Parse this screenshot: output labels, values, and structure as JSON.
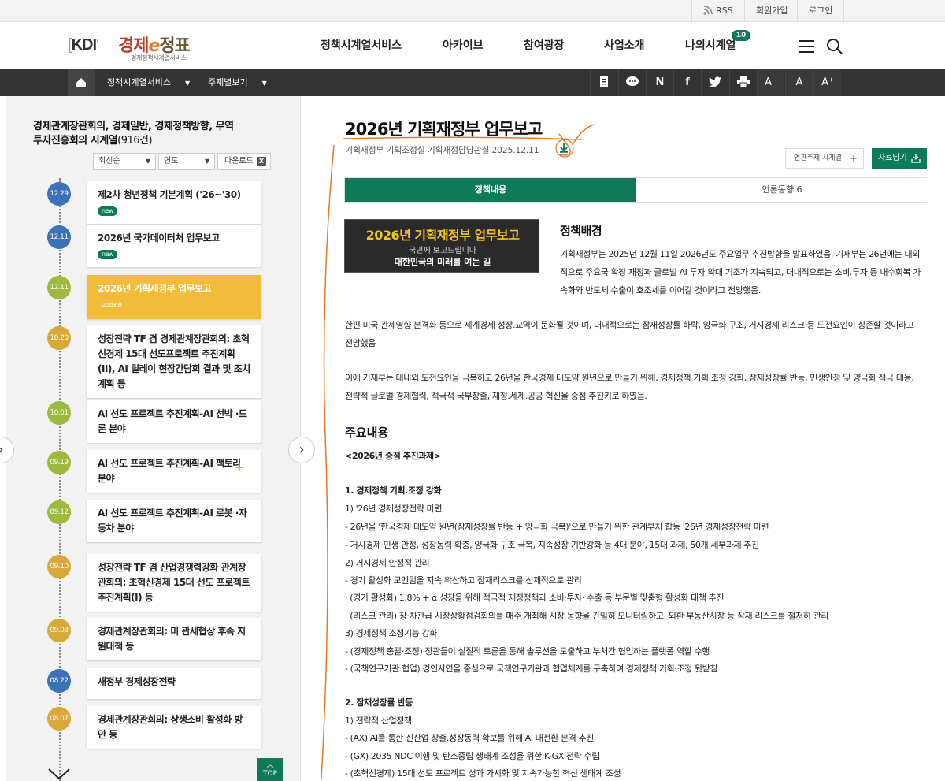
{
  "util": {
    "rss": "RSS",
    "signup": "회원가입",
    "login": "로그인"
  },
  "logo": {
    "kdi": "KDI",
    "kyungje": "경제",
    "e": "e",
    "jb": "정표",
    "sub": "경제정책시계열서비스"
  },
  "gnb": [
    "정책시계열서비스",
    "아카이브",
    "참여광장",
    "사업소개",
    "나의시계열"
  ],
  "my_badge": "10",
  "toolbar": {
    "dd1": "정책시계열서비스",
    "dd2": "주제별보기",
    "font_minus": "A⁻",
    "font_normal": "A",
    "font_plus": "A⁺"
  },
  "colors": {
    "accent": "#0f7a5a",
    "active_card": "#f2bc3a",
    "dark_bar": "#333333"
  },
  "left": {
    "title": "경제관계장관회의, 경제일반, 경제정책방향, 무역투자진흥회의",
    "title_suffix": " 시계열",
    "count": "(916건)",
    "sort": "최신순",
    "year": "연도",
    "download": "다운로드",
    "xls": "X",
    "items": [
      {
        "date": "12.29",
        "title": "제2차 청년정책 기본계획 ('26~'30)",
        "tag": "new",
        "color": "#3d72b8"
      },
      {
        "date": "12.11",
        "title": "2026년 국가데이터처 업무보고",
        "tag": "new",
        "color": "#3d72b8"
      },
      {
        "date": "12.11",
        "title": "2026년 기획재정부 업무보고",
        "tag": "update",
        "color": "#9cba3b"
      },
      {
        "date": "10.20",
        "title": "성장전략 TF 겸 경제관계장관회의: 초혁신경제 15대 선도프로젝트 추진계획(II), AI 릴레이 현장간담회 결과 및 조치계획 등",
        "tag": "",
        "color": "#d9a83a"
      },
      {
        "date": "10.01",
        "title": "AI 선도 프로젝트 추진계획-AI 선박 ·드론 분야",
        "tag": "",
        "color": "#9cba3b"
      },
      {
        "date": "09.19",
        "title": "AI 선도 프로젝트 추진계획-AI 팩토리 분야",
        "tag": "",
        "color": "#9cba3b"
      },
      {
        "date": "09.12",
        "title": "AI 선도 프로젝트 추진계획-AI 로봇 ·자동차 분야",
        "tag": "",
        "color": "#9cba3b"
      },
      {
        "date": "09.10",
        "title": "성장전략 TF 겸 산업경쟁력강화 관계장관회의: 초혁신경제 15대 선도 프로젝트 추진계획(I) 등",
        "tag": "",
        "color": "#d9a83a"
      },
      {
        "date": "09.03",
        "title": "경제관계장관회의: 미 관세협상 후속 지원대책 등",
        "tag": "",
        "color": "#d9a83a"
      },
      {
        "date": "08.22",
        "title": "새정부 경제성장전략",
        "tag": "",
        "color": "#3d72b8"
      },
      {
        "date": "08.07",
        "title": "경제관계장관회의: 상생소비 활성화 방안 등",
        "tag": "",
        "color": "#d9a83a"
      }
    ],
    "top": "TOP"
  },
  "doc": {
    "title": "2026년 기획재정부 업무보고",
    "meta": "기획재정부 기획조정실 기획재정담당관실  2025.12.11",
    "related": "연관주제 시계열",
    "save": "자료담기",
    "tab_policy": "정책내용",
    "tab_press": "언론동향 6",
    "banner1": "2026년 기획재정부 업무보고",
    "banner2": "국민께 보고드립니다",
    "banner3": "대한민국의 미래를 여는 길",
    "bg_heading": "정책배경",
    "bg_p1": "기획재정부는 2025년 12월 11일 2026년도 주요업무 추진방향을 발표하였음. 기재부는 26년에는 대외적으로 주요국 확장 재정과 글로벌 AI 투자 확대 기조가 지속되고, 대내적으로는 소비.투자 등 내수회복 가속화와 반도체 수출이 호조세를 이어갈 것이라고 전망했음.",
    "bg_p2": "한편 미국 관세영향 본격화 등으로 세계경제 성장.교역이 둔화될 것이며, 대내적으로는 잠재성장률 하락, 양극화 구조, 거시경제 리스크 등 도전요인이 상존할 것이라고 전망했음",
    "bg_p3": "이에 기재부는 대내외 도전요인을 극복하고 26년을 한국경제 대도약 원년으로 만들기 위해, 경제정책 기획.조정 강화, 잠재성장률 반등, 민생안정 및 양극화 적극 대응, 전략적 글로벌 경제협력, 적극적 국부창출, 재정.세제.공공 혁신을 중점 추진키로 하였음.",
    "main_heading": "주요내용",
    "lines": [
      {
        "t": "<2026년 중점 추진과제>",
        "b": true
      },
      {
        "t": "1. 경제정책 기획.조정 강화",
        "b": true
      },
      {
        "t": " 1) '26년 경제성장전략 마련",
        "b": false
      },
      {
        "t": " - 26년을 '한국경제 대도약 원년(잠재성장률 반등 + 양극화 극복)'으로 만들기 위한 관계부처 합동 '26년 경제성장전략 마련",
        "b": false
      },
      {
        "t": " - 거시경제·민생 안정, 성장동력 확충, 양극화 구조 극복, 지속성장 기반강화 등 4대 분야, 15대 과제, 50개 세부과제 추진",
        "b": false
      },
      {
        "t": " 2) 거시경제 안정적 관리",
        "b": false
      },
      {
        "t": " - 경기 활성화 모멘텀을 지속 확산하고 잠재리스크를 선제적으로 관리",
        "b": false
      },
      {
        "t": "  · (경기 활성화) 1.8% + α 성장을 위해 적극적 재정정책과 소비·투자· 수출 등 부문별 맞춤형 활성화 대책 추진",
        "b": false
      },
      {
        "t": "  · (리스크 관리) 장·차관급 시장상황점검회의를 매주 개최해 시장 동향을 긴밀히 모니터링하고, 외환·부동산시장 등 잠재 리스크를 철저히 관리",
        "b": false
      },
      {
        "t": " 3) 경제정책 조정기능 강화",
        "b": false
      },
      {
        "t": " - (경제정책 총괄·조정) 장관들이 실질적 토론을 통해 솔루션을 도출하고 부처간 협업하는 플랫폼 역할 수행",
        "b": false
      },
      {
        "t": " - (국책연구기관 협업) 경인사연을 중심으로 국책연구기관과 협업체계를 구축하여 경제정책 기획·조정 뒷받침",
        "b": false
      },
      {
        "t": "2. 잠재성장률 반등",
        "b": true
      },
      {
        "t": " 1) 전략적 산업정책",
        "b": false
      },
      {
        "t": " - (AX) AI를 통한 신산업 창출.성장동력 확보를 위해 AI 대전환 본격 추진",
        "b": false
      },
      {
        "t": " - (GX) 2035 NDC 이행 및 탄소중립 생태계 조성을 위한 K-GX 전략 수립",
        "b": false
      },
      {
        "t": " - (초혁신경제) 15대 선도 프로젝트 성과 가시화 및 지속가능한 혁신 생태계 조성",
        "b": false
      }
    ]
  }
}
